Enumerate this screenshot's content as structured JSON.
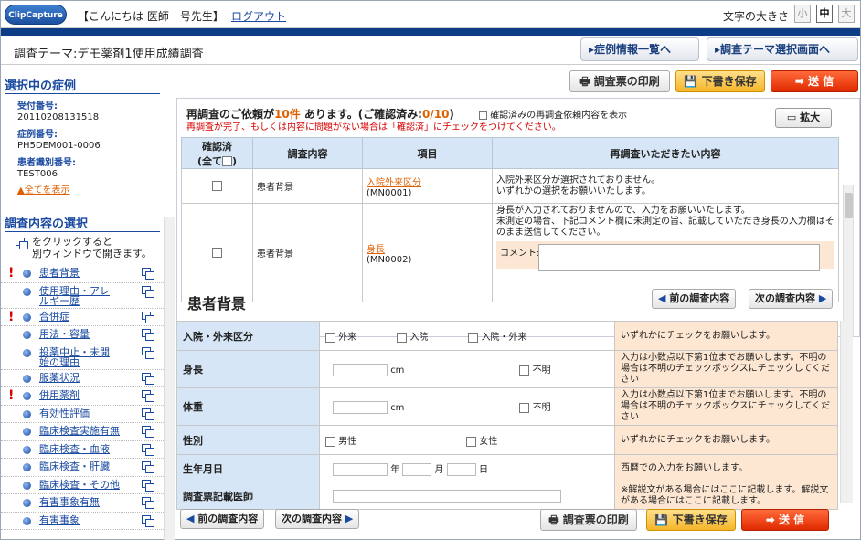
{
  "header": {
    "logo": "ClipCapture",
    "greeting": "【こんにちは 医師一号先生】",
    "logout": "ログアウト",
    "font_size_label": "文字の大きさ",
    "font_sizes": [
      "小",
      "中",
      "大"
    ]
  },
  "themebar": {
    "title": "調査テーマ:デモ薬剤1使用成績調査",
    "nav_cases": "症例情報一覧へ",
    "nav_theme": "調査テーマ選択画面へ"
  },
  "sidebar": {
    "case_heading": "選択中の症例",
    "receipt_label": "受付番号:",
    "receipt_value": "20110208131518",
    "case_label": "症例番号:",
    "case_value": "PH5DEM001-0006",
    "patient_label": "患者識別番号:",
    "patient_value": "TEST006",
    "show_all": "▲全てを表示",
    "select_heading": "調査内容の選択",
    "hint_line1": "をクリックすると",
    "hint_line2": "別ウィンドウで開きます。",
    "items": [
      {
        "label": "患者背景",
        "alert": "!"
      },
      {
        "label": "使用理由・アレルギー歴",
        "alert": ""
      },
      {
        "label": "合併症",
        "alert": "!"
      },
      {
        "label": "用法・容量",
        "alert": ""
      },
      {
        "label": "投薬中止・未開始の理由",
        "alert": ""
      },
      {
        "label": "服薬状況",
        "alert": ""
      },
      {
        "label": "併用薬剤",
        "alert": "!"
      },
      {
        "label": "有効性評価",
        "alert": ""
      },
      {
        "label": "臨床検査実施有無",
        "alert": ""
      },
      {
        "label": "臨床検査・血液",
        "alert": ""
      },
      {
        "label": "臨床検査・肝臓",
        "alert": ""
      },
      {
        "label": "臨床検査・その他",
        "alert": ""
      },
      {
        "label": "有害事象有無",
        "alert": ""
      },
      {
        "label": "有害事象",
        "alert": ""
      }
    ]
  },
  "actions": {
    "print": "調査票の印刷",
    "save": "下書き保存",
    "send": "送 信"
  },
  "request": {
    "title_a": "再調査のご依頼が",
    "count": "10件",
    "title_b": " あります。(ご確認済み:",
    "confirmed": "0/10",
    "title_c": ")",
    "show_confirmed": "確認済みの再調査依頼内容を表示",
    "warning": "再調査が完了、もしくは内容に問題がない場合は「確認済」にチェックをつけてください。",
    "enlarge": "拡大",
    "col_confirmed": "確認済",
    "col_all": "(全て",
    "col_content": "調査内容",
    "col_item": "項目",
    "col_request": "再調査いただきたい内容",
    "rows": [
      {
        "content": "患者背景",
        "item": "入院外来区分",
        "code": "(MN0001)",
        "request": "入院外来区分が選択されておりません。\nいずれかの選択をお願いいたします。"
      },
      {
        "content": "患者背景",
        "item": "身長",
        "code": "(MN0002)",
        "request": "身長が入力されておりませんので、入力をお願いいたします。\n未測定の場合、下記コメント欄に未測定の旨、記載していただき身長の入力欄はそのまま送信してください。",
        "comment_label": "コメント:"
      }
    ]
  },
  "form": {
    "title": "患者背景",
    "prev": "前の調査内容",
    "next": "次の調査内容",
    "rows": [
      {
        "label": "入院・外来区分",
        "opts": [
          "外来",
          "入院",
          "入院・外来"
        ],
        "note": "いずれかにチェックをお願いします。"
      },
      {
        "label": "身長",
        "unit": "cm",
        "unknown": "不明",
        "note": "入力は小数点以下第1位までお願いします。不明の場合は不明のチェックボックスにチェックしてください"
      },
      {
        "label": "体重",
        "unit": "cm",
        "unknown": "不明",
        "note": "入力は小数点以下第1位までお願いします。不明の場合は不明のチェックボックスにチェックしてください"
      },
      {
        "label": "性別",
        "opts": [
          "男性",
          "女性"
        ],
        "note": "いずれかにチェックをお願いします。"
      },
      {
        "label": "生年月日",
        "y": "年",
        "m": "月",
        "d": "日",
        "note": "西暦での入力をお願いします。"
      },
      {
        "label": "調査票記載医師",
        "note": "※解説文がある場合にはここに記載します。解説文がある場合にはここに記載します。"
      }
    ]
  },
  "colors": {
    "brand": "#0e3d88",
    "accent_orange": "#e06000",
    "alert": "#d80000",
    "label_bg": "#d6e6f6",
    "note_bg": "#fde7d2"
  }
}
